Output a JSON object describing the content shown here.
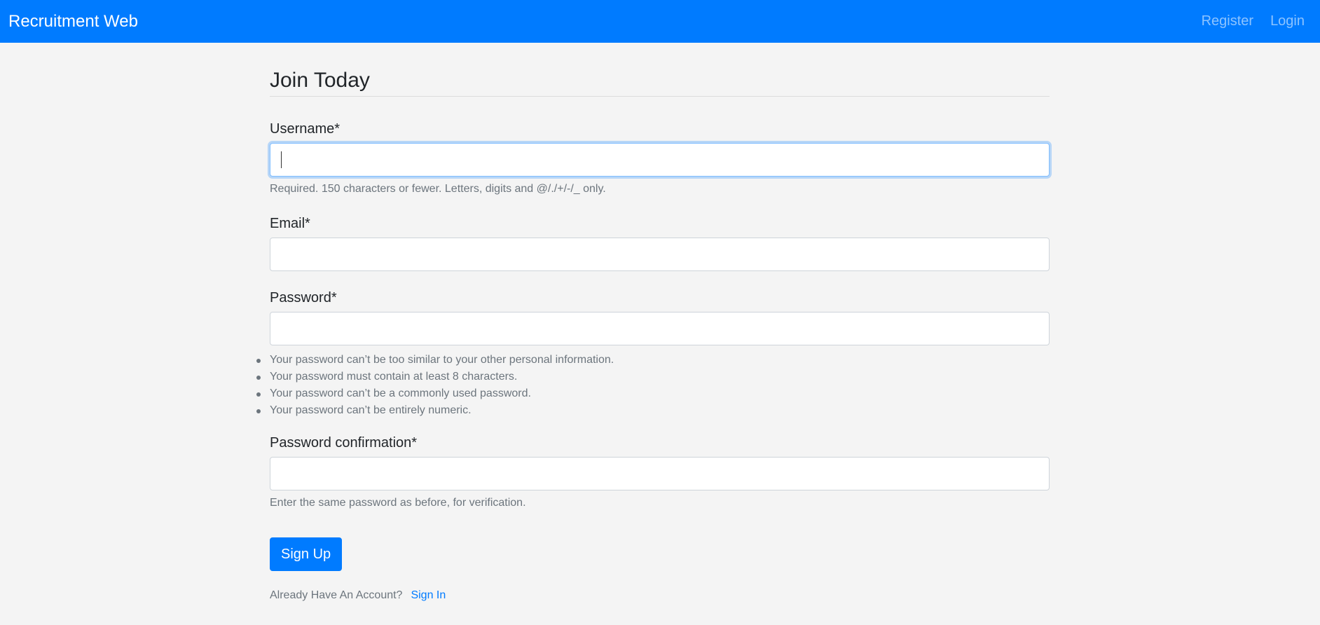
{
  "navbar": {
    "brand": "Recruitment Web",
    "links": [
      {
        "label": "Register"
      },
      {
        "label": "Login"
      }
    ],
    "background_color": "#007bff"
  },
  "page": {
    "title": "Join Today"
  },
  "form": {
    "username": {
      "label": "Username*",
      "value": "",
      "help": "Required. 150 characters or fewer. Letters, digits and @/./+/-/_ only."
    },
    "email": {
      "label": "Email*",
      "value": ""
    },
    "password": {
      "label": "Password*",
      "value": "",
      "rules": [
        "Your password can’t be too similar to your other personal information.",
        "Your password must contain at least 8 characters.",
        "Your password can’t be a commonly used password.",
        "Your password can’t be entirely numeric."
      ]
    },
    "password_confirmation": {
      "label": "Password confirmation*",
      "value": "",
      "help": "Enter the same password as before, for verification."
    },
    "submit_label": "Sign Up",
    "footer_text": "Already Have An Account?",
    "signin_label": "Sign In"
  }
}
